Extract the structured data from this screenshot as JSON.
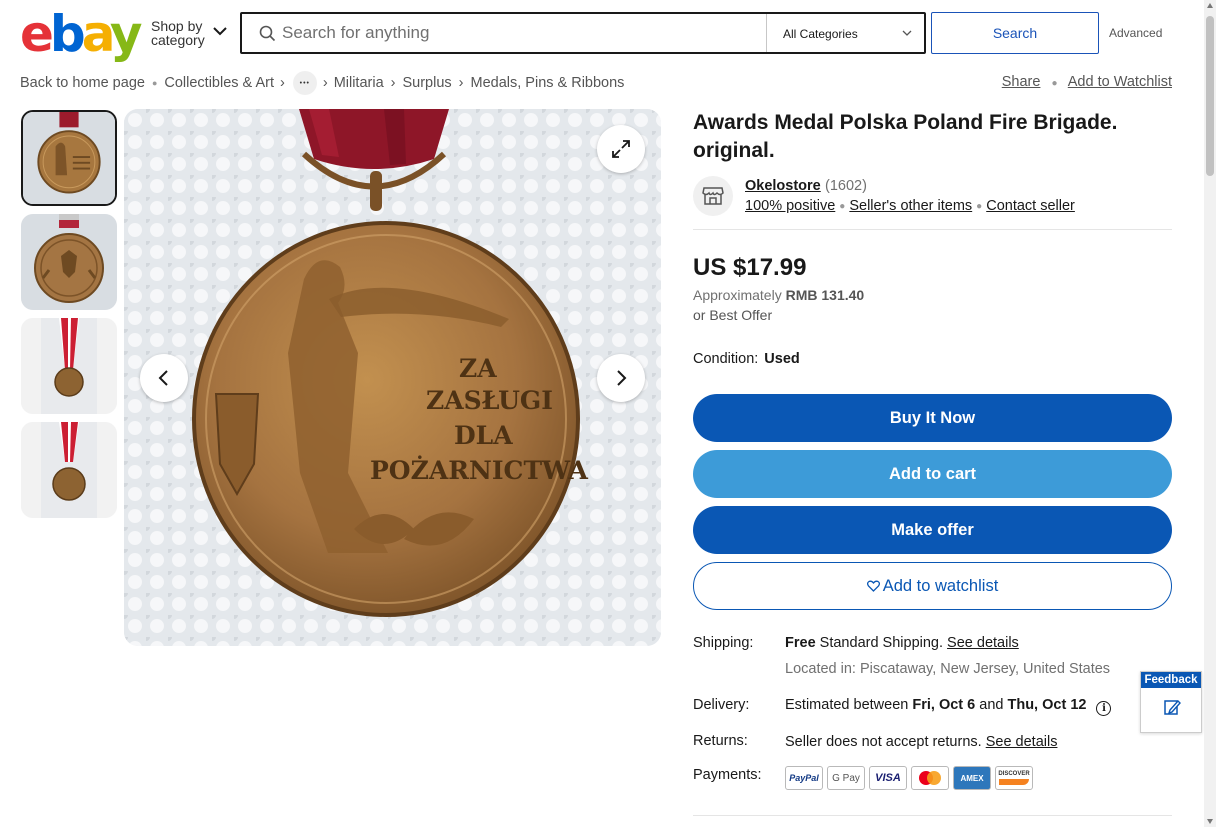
{
  "header": {
    "logo_letters": [
      "e",
      "b",
      "a",
      "y"
    ],
    "logo_colors": [
      "#e53238",
      "#0064d2",
      "#f5af02",
      "#86b817"
    ],
    "shop_by_line1": "Shop by",
    "shop_by_line2": "category",
    "search_placeholder": "Search for anything",
    "category_selected": "All Categories",
    "search_button": "Search",
    "advanced_link": "Advanced"
  },
  "breadcrumb": {
    "items": [
      "Back to home page",
      "Collectibles & Art",
      "Militaria",
      "Surplus",
      "Medals, Pins & Ribbons"
    ],
    "more": "•••"
  },
  "share_links": {
    "share": "Share",
    "watchlist": "Add to Watchlist"
  },
  "gallery": {
    "thumbnail_count": 4,
    "medal_text": [
      "ZA",
      "ZASŁUGI",
      "DLA",
      "POŻARNICTWA"
    ]
  },
  "item": {
    "title": "Awards Medal Polska Poland Fire Brigade. original.",
    "seller": {
      "name": "Okelostore",
      "feedback_count": "(1602)",
      "positive": "100% positive",
      "other_items": "Seller's other items",
      "contact": "Contact seller"
    },
    "price": "US $17.99",
    "approx_label": "Approximately",
    "approx_value": "RMB 131.40",
    "best_offer": "or Best Offer",
    "condition_label": "Condition:",
    "condition_value": "Used"
  },
  "buttons": {
    "buy_now": "Buy It Now",
    "add_to_cart": "Add to cart",
    "make_offer": "Make offer",
    "add_to_watchlist": "Add to watchlist"
  },
  "details": {
    "shipping_label": "Shipping:",
    "shipping_free": "Free",
    "shipping_text": "Standard Shipping.",
    "shipping_link": "See details",
    "location": "Located in: Piscataway, New Jersey, United States",
    "delivery_label": "Delivery:",
    "delivery_prefix": "Estimated between",
    "delivery_start": "Fri, Oct 6",
    "delivery_and": "and",
    "delivery_end": "Thu, Oct 12",
    "returns_label": "Returns:",
    "returns_text": "Seller does not accept returns.",
    "returns_link": "See details",
    "payments_label": "Payments:",
    "payment_methods": [
      "PayPal",
      "G Pay",
      "VISA",
      "Mastercard",
      "AMEX",
      "DISCOVER"
    ]
  },
  "feedback": {
    "label": "Feedback"
  },
  "colors": {
    "primary_blue": "#0a57b4",
    "cart_blue": "#3d9bd8",
    "text": "#191919",
    "muted": "#707070"
  }
}
